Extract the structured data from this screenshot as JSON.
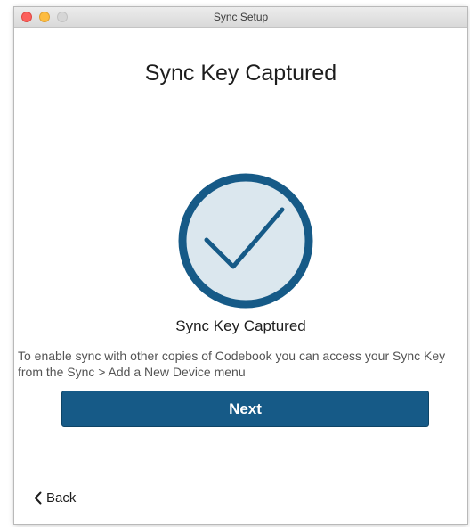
{
  "window": {
    "title": "Sync Setup"
  },
  "page": {
    "heading": "Sync Key Captured",
    "subheading": "Sync Key Captured",
    "description": "To enable sync with other copies of Codebook you can access your Sync Key from the Sync > Add a New Device menu"
  },
  "icons": {
    "status": "checkmark-circle-icon",
    "back": "chevron-left-icon"
  },
  "buttons": {
    "next_label": "Next",
    "back_label": "Back"
  },
  "colors": {
    "accent": "#165a87",
    "circle_fill": "#dbe7ee",
    "circle_stroke": "#165a87"
  }
}
